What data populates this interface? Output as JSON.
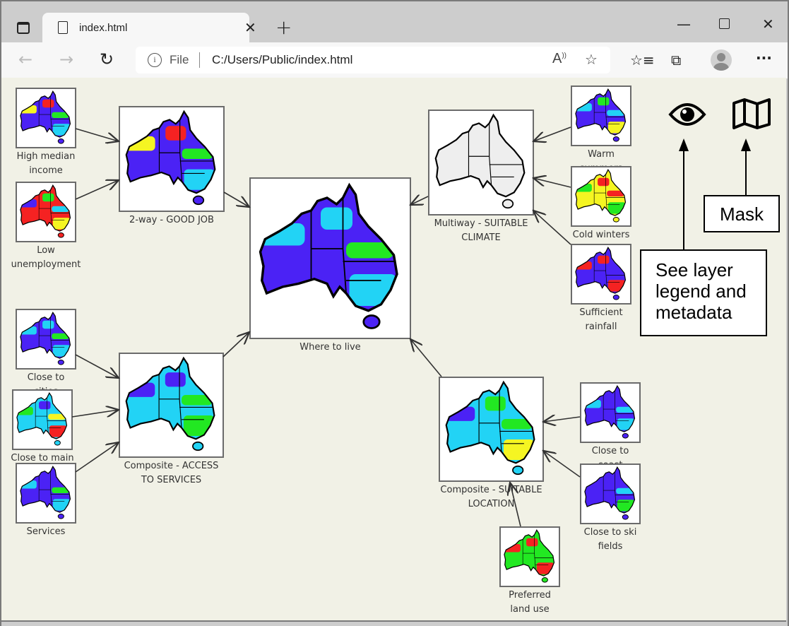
{
  "browser": {
    "tab_title": "index.html",
    "address_scheme": "File",
    "address_url": "C:/Users/Public/index.html",
    "icons": [
      "tab-actions-icon",
      "document-icon",
      "close-icon",
      "new-tab-icon",
      "minimize-icon",
      "maximize-icon",
      "window-close-icon",
      "back-icon",
      "forward-icon",
      "refresh-icon",
      "info-icon",
      "read-aloud-icon",
      "add-favorite-icon",
      "favorites-icon",
      "collections-icon",
      "profile-icon",
      "more-icon"
    ]
  },
  "colors": {
    "blue": "#4b22f5",
    "cyan": "#22d3f5",
    "green": "#22e822",
    "yellow": "#f5f522",
    "red": "#f52222",
    "grey": "#eeeeee",
    "background": "#f1f1e6"
  },
  "nodes": [
    {
      "id": "income",
      "label": "High median income",
      "base": "blue",
      "accents": [
        "yellow",
        "red",
        "green",
        "cyan"
      ]
    },
    {
      "id": "unemp",
      "label": "Low unemployment",
      "base": "red",
      "accents": [
        "blue",
        "green",
        "cyan",
        "yellow"
      ]
    },
    {
      "id": "goodjob",
      "label": "2-way - GOOD JOB",
      "base": "blue",
      "accents": [
        "yellow",
        "red",
        "green",
        "cyan"
      ]
    },
    {
      "id": "where",
      "label": "Where to live",
      "base": "blue",
      "accents": [
        "cyan",
        "cyan",
        "green",
        "cyan"
      ]
    },
    {
      "id": "climate",
      "label": "Multiway - SUITABLE CLIMATE",
      "base": "grey",
      "accents": []
    },
    {
      "id": "warm",
      "label": "Warm summers",
      "base": "blue",
      "accents": [
        "cyan",
        "green",
        "cyan",
        "yellow"
      ]
    },
    {
      "id": "cold",
      "label": "Cold winters",
      "base": "yellow",
      "accents": [
        "green",
        "red",
        "red",
        "green"
      ]
    },
    {
      "id": "rain",
      "label": "Sufficient rainfall",
      "base": "blue",
      "accents": [
        "red",
        "red",
        "blue",
        "red"
      ]
    },
    {
      "id": "cities",
      "label": "Close to cities",
      "base": "blue",
      "accents": [
        "cyan",
        "cyan",
        "green",
        "cyan"
      ]
    },
    {
      "id": "roads",
      "label": "Close to main roads",
      "base": "cyan",
      "accents": [
        "green",
        "blue",
        "yellow",
        "red"
      ]
    },
    {
      "id": "services",
      "label": "Services",
      "base": "blue",
      "accents": [
        "cyan",
        "blue",
        "green",
        "cyan"
      ]
    },
    {
      "id": "access",
      "label": "Composite - ACCESS TO SERVICES",
      "base": "cyan",
      "accents": [
        "blue",
        "blue",
        "green",
        "green"
      ]
    },
    {
      "id": "location",
      "label": "Composite - SUITABLE LOCATION",
      "base": "cyan",
      "accents": [
        "blue",
        "green",
        "green",
        "yellow"
      ]
    },
    {
      "id": "coast",
      "label": "Close to coast",
      "base": "blue",
      "accents": [
        "cyan",
        "blue",
        "cyan",
        "cyan"
      ]
    },
    {
      "id": "ski",
      "label": "Close to ski fields",
      "base": "blue",
      "accents": [
        "blue",
        "blue",
        "cyan",
        "green"
      ]
    },
    {
      "id": "landuse",
      "label": "Preferred land use",
      "base": "green",
      "accents": [
        "red",
        "red",
        "green",
        "red"
      ]
    }
  ],
  "edges": [
    [
      "income",
      "goodjob"
    ],
    [
      "unemp",
      "goodjob"
    ],
    [
      "goodjob",
      "where"
    ],
    [
      "cities",
      "access"
    ],
    [
      "roads",
      "access"
    ],
    [
      "services",
      "access"
    ],
    [
      "access",
      "where"
    ],
    [
      "warm",
      "climate"
    ],
    [
      "cold",
      "climate"
    ],
    [
      "rain",
      "climate"
    ],
    [
      "climate",
      "where"
    ],
    [
      "coast",
      "location"
    ],
    [
      "ski",
      "location"
    ],
    [
      "landuse",
      "location"
    ],
    [
      "location",
      "where"
    ]
  ],
  "toolbar_icons": {
    "legend": "eye-icon",
    "mask": "map-icon"
  },
  "callouts": {
    "legend": "See layer legend and metadata",
    "mask": "Mask"
  }
}
